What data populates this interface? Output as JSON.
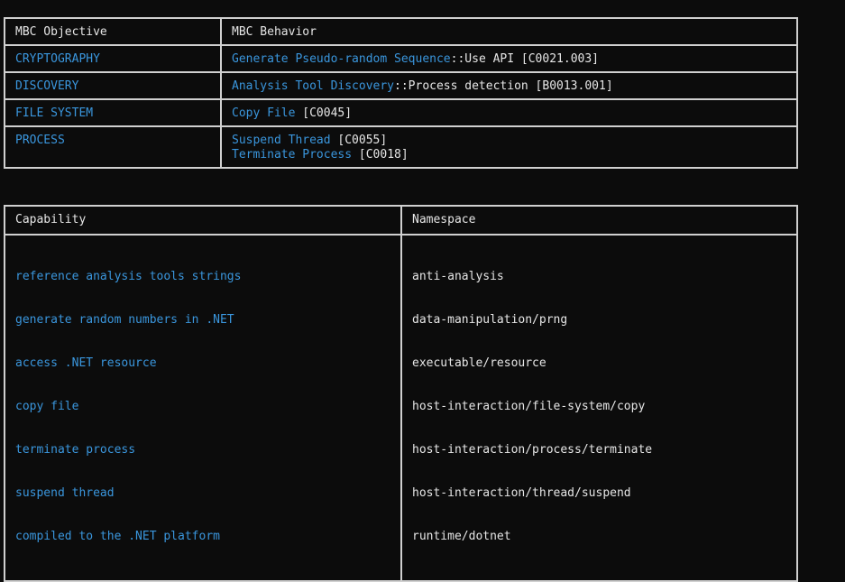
{
  "mbc_table": {
    "headers": [
      "MBC Objective",
      "MBC Behavior"
    ],
    "rows": [
      {
        "objective": "CRYPTOGRAPHY",
        "behaviors": [
          {
            "name": "Generate Pseudo-random Sequence",
            "suffix": "::Use API [C0021.003]"
          }
        ]
      },
      {
        "objective": "DISCOVERY",
        "behaviors": [
          {
            "name": "Analysis Tool Discovery",
            "suffix": "::Process detection [B0013.001]"
          }
        ]
      },
      {
        "objective": "FILE SYSTEM",
        "behaviors": [
          {
            "name": "Copy File",
            "suffix": " [C0045]"
          }
        ]
      },
      {
        "objective": "PROCESS",
        "behaviors": [
          {
            "name": "Suspend Thread",
            "suffix": " [C0055]"
          },
          {
            "name": "Terminate Process",
            "suffix": " [C0018]"
          }
        ]
      }
    ]
  },
  "capability_table": {
    "headers": [
      "Capability",
      "Namespace"
    ],
    "capabilities": [
      "reference analysis tools strings",
      "generate random numbers in .NET",
      "access .NET resource",
      "copy file",
      "terminate process",
      "suspend thread",
      "compiled to the .NET platform"
    ],
    "namespaces": [
      "anti-analysis",
      "data-manipulation/prng",
      "executable/resource",
      "host-interaction/file-system/copy",
      "host-interaction/process/terminate",
      "host-interaction/thread/suspend",
      "runtime/dotnet"
    ]
  },
  "colors": {
    "background": "#0c0c0c",
    "text": "#e6e6e6",
    "accent_blue": "#3a96dd",
    "border": "#d0d0d0"
  }
}
